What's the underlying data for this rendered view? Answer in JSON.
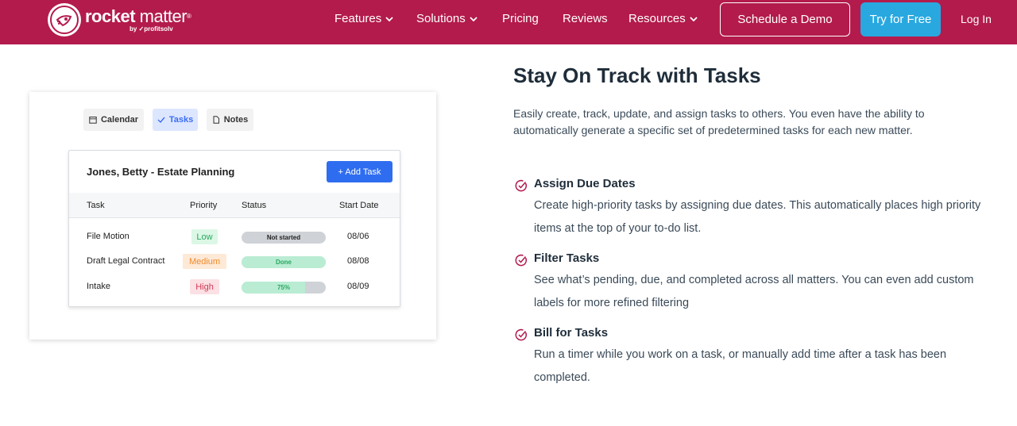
{
  "nav": {
    "logo_brand_bold": "rocket",
    "logo_brand_light": "matter",
    "logo_reg": "®",
    "logo_byline": "by ✓profitsolv",
    "links": [
      {
        "label": "Features",
        "has_dropdown": true
      },
      {
        "label": "Solutions",
        "has_dropdown": true
      },
      {
        "label": "Pricing",
        "has_dropdown": false
      },
      {
        "label": "Reviews",
        "has_dropdown": false
      },
      {
        "label": "Resources",
        "has_dropdown": true
      }
    ],
    "schedule_demo": "Schedule a Demo",
    "try_free": "Try for Free",
    "login": "Log In",
    "colors": {
      "bar": "#b31b4c",
      "try_button": "#29a8e0"
    }
  },
  "app_preview": {
    "tabs": [
      {
        "label": "Calendar",
        "icon": "calendar-icon",
        "active": false
      },
      {
        "label": "Tasks",
        "icon": "check-icon",
        "active": true
      },
      {
        "label": "Notes",
        "icon": "document-icon",
        "active": false
      }
    ],
    "panel_title": "Jones, Betty - Estate Planning",
    "add_task": "+ Add Task",
    "columns": [
      "Task",
      "Priority",
      "Status",
      "Start Date"
    ],
    "rows": [
      {
        "task": "File Motion",
        "priority": "Low",
        "status": "Not started",
        "progress": 0,
        "start": "08/06"
      },
      {
        "task": "Draft Legal Contract",
        "priority": "Medium",
        "status": "Done",
        "progress": 1,
        "start": "08/08"
      },
      {
        "task": "Intake",
        "priority": "High",
        "status": "75%",
        "progress": 0.75,
        "start": "08/09"
      }
    ]
  },
  "content": {
    "heading": "Stay On Track with Tasks",
    "intro": "Easily create, track, update, and assign tasks to others. You even have the ability to automatically generate a specific set of predetermined tasks for each new matter.",
    "features": [
      {
        "title": "Assign Due Dates",
        "desc": "Create high-priority tasks by assigning due dates. This automatically places high priority items at the top of your to-do list."
      },
      {
        "title": "Filter Tasks",
        "desc": "See what’s pending, due, and completed across all matters. You can even add custom labels for more refined filtering"
      },
      {
        "title": "Bill for Tasks",
        "desc": "Run a timer while you work on a task, or manually add time after a task has been completed."
      }
    ]
  }
}
